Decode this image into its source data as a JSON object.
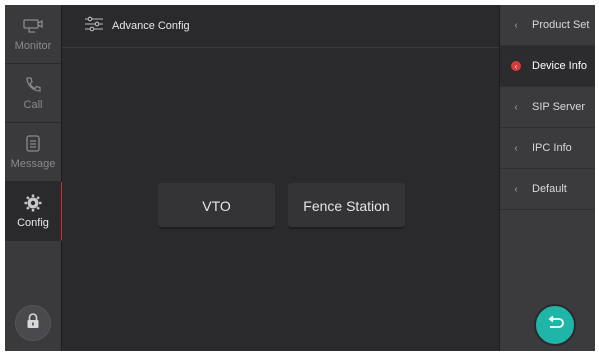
{
  "nav": {
    "items": [
      {
        "label": "Monitor",
        "icon": "camera-icon"
      },
      {
        "label": "Call",
        "icon": "phone-icon"
      },
      {
        "label": "Message",
        "icon": "message-icon"
      },
      {
        "label": "Config",
        "icon": "gear-icon"
      }
    ],
    "active_index": 3
  },
  "topbar": {
    "title": "Advance Config",
    "icon": "sliders-icon"
  },
  "main": {
    "buttons": [
      {
        "label": "VTO"
      },
      {
        "label": "Fence Station"
      }
    ]
  },
  "rightpanel": {
    "items": [
      {
        "label": "Product Set"
      },
      {
        "label": "Device Info"
      },
      {
        "label": "SIP Server"
      },
      {
        "label": "IPC Info"
      },
      {
        "label": "Default"
      }
    ],
    "active_index": 1,
    "back_icon": "back-arrow-icon"
  },
  "colors": {
    "accent_teal": "#1fb5a8",
    "active_red": "#d02a2a"
  }
}
